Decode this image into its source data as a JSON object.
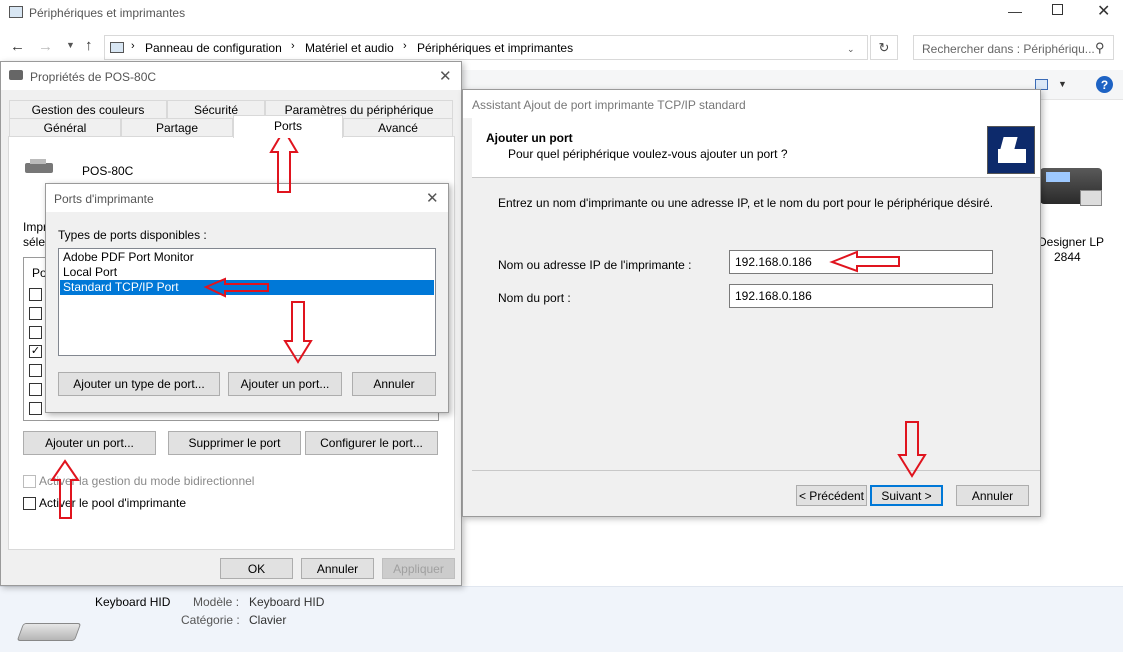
{
  "explorer": {
    "title": "Périphériques et imprimantes",
    "breadcrumb": [
      "Panneau de configuration",
      "Matériel et audio",
      "Périphériques et imprimantes"
    ],
    "search_placeholder": "Rechercher dans : Périphériqu...",
    "device_right_label_1": "Designer LP",
    "device_right_label_2": "2844",
    "keyboard": {
      "name": "Keyboard HID",
      "model_label": "Modèle :",
      "model_value": "Keyboard HID",
      "category_label": "Catégorie :",
      "category_value": "Clavier"
    }
  },
  "props": {
    "title": "Propriétés de POS-80C",
    "tabs_row1": [
      "Gestion des couleurs",
      "Sécurité",
      "Paramètres du périphérique"
    ],
    "tabs_row2": [
      "Général",
      "Partage",
      "Ports",
      "Avancé"
    ],
    "printer_name": "POS-80C",
    "partial_text_1": "Impr",
    "partial_text_2": "sélec",
    "list_header": "Po",
    "add_port": "Ajouter un port...",
    "delete_port": "Supprimer le port",
    "configure_port": "Configurer le port...",
    "bidir": "Activer la gestion du mode bidirectionnel",
    "pool": "Activer le pool d'imprimante",
    "ok": "OK",
    "cancel": "Annuler",
    "apply": "Appliquer"
  },
  "ports_dialog": {
    "title": "Ports d'imprimante",
    "types_label": "Types de ports disponibles :",
    "items": [
      "Adobe PDF Port Monitor",
      "Local Port",
      "Standard TCP/IP Port"
    ],
    "selected_index": 2,
    "add_type": "Ajouter un type de port...",
    "add_port": "Ajouter un port...",
    "cancel": "Annuler"
  },
  "wizard": {
    "title": "Assistant Ajout de port imprimante TCP/IP standard",
    "heading": "Ajouter un port",
    "subheading": "Pour quel périphérique voulez-vous ajouter un port ?",
    "instructions": "Entrez un nom d'imprimante ou une adresse IP, et le nom du port pour le périphérique désiré.",
    "ip_label": "Nom ou adresse IP de l'imprimante :",
    "ip_value": "192.168.0.186",
    "port_label": "Nom du port :",
    "port_value": "192.168.0.186",
    "back": "< Précédent",
    "next": "Suivant >",
    "cancel": "Annuler"
  },
  "colors": {
    "selection": "#0078d7",
    "arrow": "#e0141e",
    "dialog_bg": "#f0f0f0"
  }
}
